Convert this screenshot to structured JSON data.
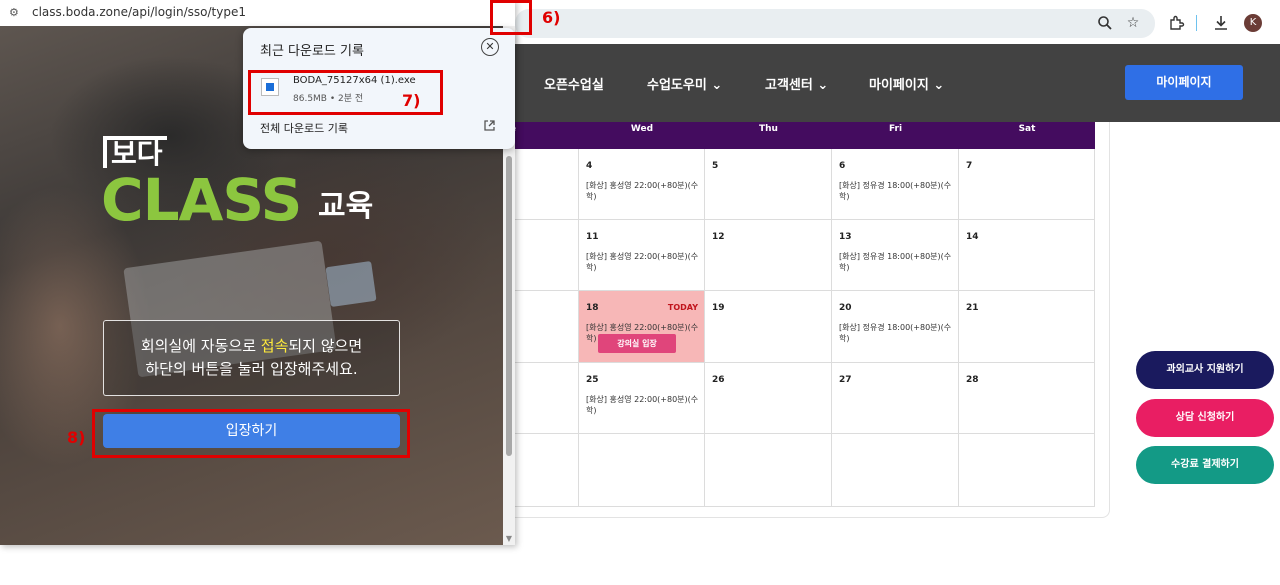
{
  "popup": {
    "url": "class.boda.zone/api/login/sso/type1",
    "logo_top": "보다",
    "logo_main": "CLASS",
    "logo_suffix": "교육",
    "message_line1_pre": "회의실에 자동으로 ",
    "message_line1_hl": "접속",
    "message_line1_post": "되지 않으면",
    "message_line2": "하단의 버튼을 눌러 입장해주세요.",
    "enter_button": "입장하기"
  },
  "downloads": {
    "title": "최근 다운로드 기록",
    "file_name": "BODA_75127x64 (1).exe",
    "file_meta": "86.5MB • 2분 전",
    "all_history": "전체 다운로드 기록"
  },
  "browser": {
    "avatar_letter": "K"
  },
  "nav": {
    "items": [
      "오픈수업실",
      "수업도우미 ⌄",
      "고객센터 ⌄",
      "마이페이지 ⌄"
    ],
    "mypage_button": "마이페이지"
  },
  "calendar": {
    "days": [
      "e",
      "Wed",
      "Thu",
      "Fri",
      "Sat"
    ],
    "today_label": "TODAY",
    "enter_room": "강의실 입장",
    "rows": [
      [
        {
          "num": "",
          "ev": ""
        },
        {
          "num": "4",
          "ev": "[화상] 홍성영 22:00(+80분)(수학)"
        },
        {
          "num": "5",
          "ev": ""
        },
        {
          "num": "6",
          "ev": "[화상] 정유경 18:00(+80분)(수학)"
        },
        {
          "num": "7",
          "ev": ""
        }
      ],
      [
        {
          "num": "",
          "ev": ""
        },
        {
          "num": "11",
          "ev": "[화상] 홍성영 22:00(+80분)(수학)"
        },
        {
          "num": "12",
          "ev": ""
        },
        {
          "num": "13",
          "ev": "[화상] 정유경 18:00(+80분)(수학)"
        },
        {
          "num": "14",
          "ev": ""
        }
      ],
      [
        {
          "num": "",
          "ev": ""
        },
        {
          "num": "18",
          "ev": "[화상] 홍성영 22:00(+80분)(수학)"
        },
        {
          "num": "19",
          "ev": ""
        },
        {
          "num": "20",
          "ev": "[화상] 정유경 18:00(+80분)(수학)"
        },
        {
          "num": "21",
          "ev": ""
        }
      ],
      [
        {
          "num": "",
          "ev": ""
        },
        {
          "num": "25",
          "ev": "[화상] 홍성영 22:00(+80분)(수학)"
        },
        {
          "num": "26",
          "ev": ""
        },
        {
          "num": "27",
          "ev": ""
        },
        {
          "num": "28",
          "ev": ""
        }
      ],
      [
        {
          "num": "",
          "ev": ""
        },
        {
          "num": "",
          "ev": ""
        },
        {
          "num": "",
          "ev": ""
        },
        {
          "num": "",
          "ev": ""
        },
        {
          "num": "",
          "ev": ""
        }
      ]
    ]
  },
  "floating_buttons": {
    "apply_tutor": "과외교사 지원하기",
    "consult": "상담 신청하기",
    "payment": "수강료 결제하기"
  },
  "annotations": {
    "label6": "6)",
    "label7": "7)",
    "label8": "8)"
  },
  "colors": {
    "nav_bg": "#424242",
    "calendar_header": "#440c5f",
    "today_cell": "#f7b7b7",
    "accent_blue": "#2f6fe6",
    "brand_green": "#8cc63f",
    "fab_navy": "#1a1a5e",
    "fab_pink": "#e91e63",
    "fab_teal": "#139a86",
    "annotation_red": "#e00000"
  }
}
